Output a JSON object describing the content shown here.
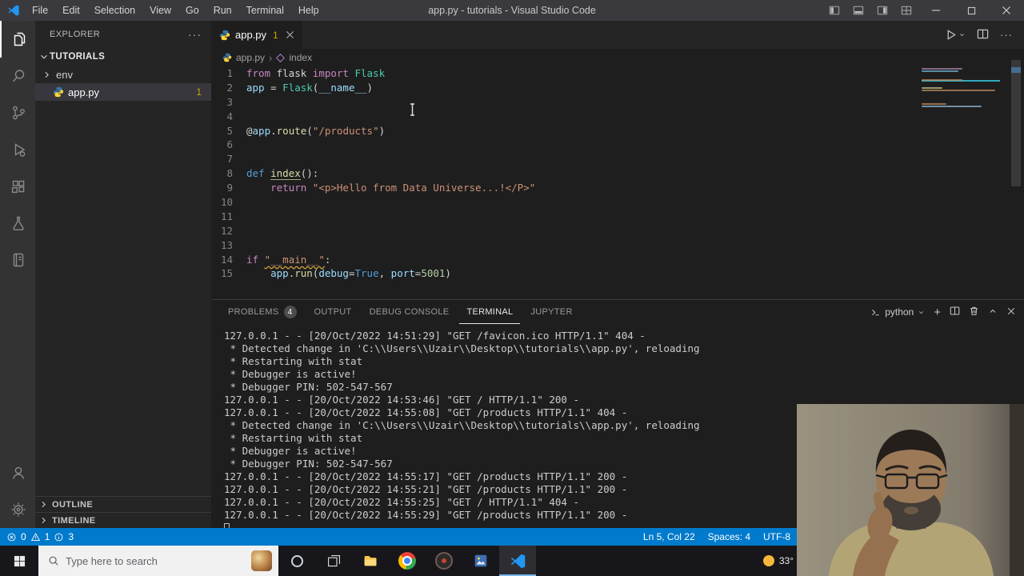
{
  "colors": {
    "accent": "#007acc",
    "statusbar": "#007acc",
    "warning_badge": "#cca700",
    "editor_background": "#1e1e1e",
    "vscode_blue": "#2196f3"
  },
  "title_bar": {
    "title": "app.py - tutorials - Visual Studio Code",
    "menus": [
      "File",
      "Edit",
      "Selection",
      "View",
      "Go",
      "Run",
      "Terminal",
      "Help"
    ]
  },
  "sidebar": {
    "title": "EXPLORER",
    "workspace": "TUTORIALS",
    "items": [
      {
        "name": "env",
        "type": "folder"
      },
      {
        "name": "app.py",
        "type": "python-file",
        "badge": "1",
        "selected": true
      }
    ],
    "sections": [
      {
        "label": "OUTLINE"
      },
      {
        "label": "TIMELINE"
      }
    ]
  },
  "editor": {
    "tab": {
      "label": "app.py",
      "badge": "1"
    },
    "breadcrumbs": [
      {
        "label": "app.py"
      },
      {
        "label": "index"
      }
    ],
    "code": [
      {
        "n": "1",
        "t": [
          [
            "k",
            "from"
          ],
          [
            "t",
            " flask "
          ],
          [
            "k",
            "import"
          ],
          [
            "t",
            " "
          ],
          [
            "c",
            "Flask"
          ]
        ]
      },
      {
        "n": "2",
        "t": [
          [
            "v",
            "app"
          ],
          [
            "t",
            " = "
          ],
          [
            "c",
            "Flask"
          ],
          [
            "t",
            "("
          ],
          [
            "v",
            "__name__"
          ],
          [
            "t",
            ")"
          ]
        ]
      },
      {
        "n": "3",
        "t": []
      },
      {
        "n": "4",
        "t": []
      },
      {
        "n": "5",
        "t": [
          [
            "t",
            "@"
          ],
          [
            "v",
            "app"
          ],
          [
            "t",
            "."
          ],
          [
            "f",
            "route"
          ],
          [
            "t",
            "("
          ],
          [
            "s",
            "\"/products\""
          ],
          [
            "t",
            ")"
          ]
        ]
      },
      {
        "n": "6",
        "t": []
      },
      {
        "n": "7",
        "t": []
      },
      {
        "n": "8",
        "t": [
          [
            "d",
            "def"
          ],
          [
            "t",
            " "
          ],
          [
            "fu",
            "index"
          ],
          [
            "t",
            "():"
          ]
        ]
      },
      {
        "n": "9",
        "t": [
          [
            "t",
            "    "
          ],
          [
            "k",
            "return"
          ],
          [
            "t",
            " "
          ],
          [
            "s",
            "\"<p>Hello from Data Universe...!</P>\""
          ]
        ]
      },
      {
        "n": "10",
        "t": []
      },
      {
        "n": "11",
        "t": []
      },
      {
        "n": "12",
        "t": []
      },
      {
        "n": "13",
        "t": []
      },
      {
        "n": "14",
        "t": [
          [
            "k",
            "if"
          ],
          [
            "t",
            " "
          ],
          [
            "sw",
            "\"__main__\""
          ],
          [
            "t",
            ":"
          ]
        ]
      },
      {
        "n": "15",
        "t": [
          [
            "t",
            "    "
          ],
          [
            "v",
            "app"
          ],
          [
            "t",
            "."
          ],
          [
            "f",
            "run"
          ],
          [
            "t",
            "("
          ],
          [
            "v",
            "debug"
          ],
          [
            "t",
            "="
          ],
          [
            "d",
            "True"
          ],
          [
            "t",
            ", "
          ],
          [
            "v",
            "port"
          ],
          [
            "t",
            "="
          ],
          [
            "num",
            "5001"
          ],
          [
            "t",
            ")"
          ]
        ]
      }
    ]
  },
  "panel": {
    "tabs": [
      {
        "label": "PROBLEMS",
        "badge": "4"
      },
      {
        "label": "OUTPUT"
      },
      {
        "label": "DEBUG CONSOLE"
      },
      {
        "label": "TERMINAL",
        "active": true
      },
      {
        "label": "JUPYTER"
      }
    ],
    "shell_label": "python",
    "terminal_lines": [
      "127.0.0.1 - - [20/Oct/2022 14:51:29] \"GET /favicon.ico HTTP/1.1\" 404 -",
      " * Detected change in 'C:\\\\Users\\\\Uzair\\\\Desktop\\\\tutorials\\\\app.py', reloading",
      " * Restarting with stat",
      " * Debugger is active!",
      " * Debugger PIN: 502-547-567",
      "127.0.0.1 - - [20/Oct/2022 14:53:46] \"GET / HTTP/1.1\" 200 -",
      "127.0.0.1 - - [20/Oct/2022 14:55:08] \"GET /products HTTP/1.1\" 404 -",
      " * Detected change in 'C:\\\\Users\\\\Uzair\\\\Desktop\\\\tutorials\\\\app.py', reloading",
      " * Restarting with stat",
      " * Debugger is active!",
      " * Debugger PIN: 502-547-567",
      "127.0.0.1 - - [20/Oct/2022 14:55:17] \"GET /products HTTP/1.1\" 200 -",
      "127.0.0.1 - - [20/Oct/2022 14:55:21] \"GET /products HTTP/1.1\" 200 -",
      "127.0.0.1 - - [20/Oct/2022 14:55:25] \"GET / HTTP/1.1\" 404 -",
      "127.0.0.1 - - [20/Oct/2022 14:55:29] \"GET /products HTTP/1.1\" 200 -"
    ]
  },
  "status_bar": {
    "errors": "0",
    "warnings": "1",
    "info": "3",
    "cursor": "Ln 5, Col 22",
    "indent": "Spaces: 4",
    "encoding": "UTF-8"
  },
  "taskbar": {
    "search_placeholder": "Type here to search",
    "weather": "33°"
  }
}
